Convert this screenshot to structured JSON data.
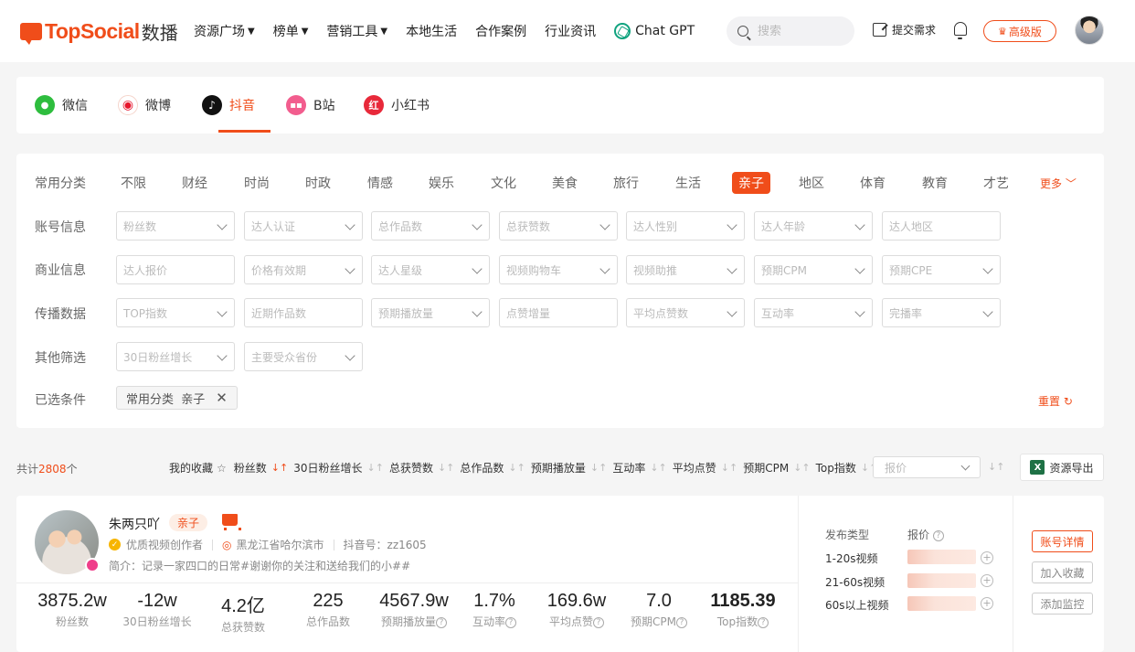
{
  "brand": {
    "name": "TopSocial",
    "suffix": "数播"
  },
  "nav": {
    "items": [
      "资源广场",
      "榜单",
      "营销工具",
      "本地生活",
      "合作案例",
      "行业资讯"
    ],
    "chatgpt": "Chat GPT",
    "search_placeholder": "搜索",
    "submit": "提交需求",
    "premium": "高级版"
  },
  "platforms": [
    "微信",
    "微博",
    "抖音",
    "B站",
    "小红书"
  ],
  "filters": {
    "labels": [
      "常用分类",
      "账号信息",
      "商业信息",
      "传播数据",
      "其他筛选",
      "已选条件"
    ],
    "categories": [
      "不限",
      "财经",
      "时尚",
      "时政",
      "情感",
      "娱乐",
      "文化",
      "美食",
      "旅行",
      "生活",
      "亲子",
      "地区",
      "体育",
      "教育",
      "才艺"
    ],
    "more": "更多",
    "row_account": [
      "粉丝数",
      "达人认证",
      "总作品数",
      "总获赞数",
      "达人性别",
      "达人年龄",
      "达人地区"
    ],
    "row_business": [
      "达人报价",
      "价格有效期",
      "达人星级",
      "视频购物车",
      "视频助推",
      "预期CPM",
      "预期CPE"
    ],
    "row_spread": [
      "TOP指数",
      "近期作品数",
      "预期播放量",
      "点赞增量",
      "平均点赞数",
      "互动率",
      "完播率"
    ],
    "row_other": [
      "30日粉丝增长",
      "主要受众省份"
    ],
    "chip_key": "常用分类",
    "chip_value": "亲子",
    "reset": "重置"
  },
  "sortbar": {
    "total_prefix": "共计",
    "total_count": "2808",
    "total_suffix": "个",
    "favorites": "我的收藏",
    "items": [
      "粉丝数",
      "30日粉丝增长",
      "总获赞数",
      "总作品数",
      "预期播放量",
      "互动率",
      "平均点赞",
      "预期CPM",
      "Top指数"
    ],
    "price_placeholder": "报价",
    "export": "资源导出"
  },
  "result": {
    "name": "朱两只吖",
    "tag": "亲子",
    "creator": "优质视频创作者",
    "location": "黑龙江省哈尔滨市",
    "douyin_id": "抖音号：zz1605",
    "intro": "简介：记录一家四口的日常#谢谢你的关注和送给我们的小##",
    "stats": [
      {
        "value": "3875.2w",
        "label": "粉丝数"
      },
      {
        "value": "-12w",
        "label": "30日粉丝增长"
      },
      {
        "value": "4.2亿",
        "label": "总获赞数"
      },
      {
        "value": "225",
        "label": "总作品数"
      },
      {
        "value": "4567.9w",
        "label": "预期播放量"
      },
      {
        "value": "1.7%",
        "label": "互动率"
      },
      {
        "value": "169.6w",
        "label": "平均点赞"
      },
      {
        "value": "7.0",
        "label": "预期CPM"
      },
      {
        "value": "1185.39",
        "label": "Top指数"
      }
    ],
    "pub_type": "发布类型",
    "price": "报价",
    "pub_rows": [
      "1-20s视频",
      "21-60s视频",
      "60s以上视频"
    ],
    "buttons": [
      "账号详情",
      "加入收藏",
      "添加监控"
    ]
  }
}
